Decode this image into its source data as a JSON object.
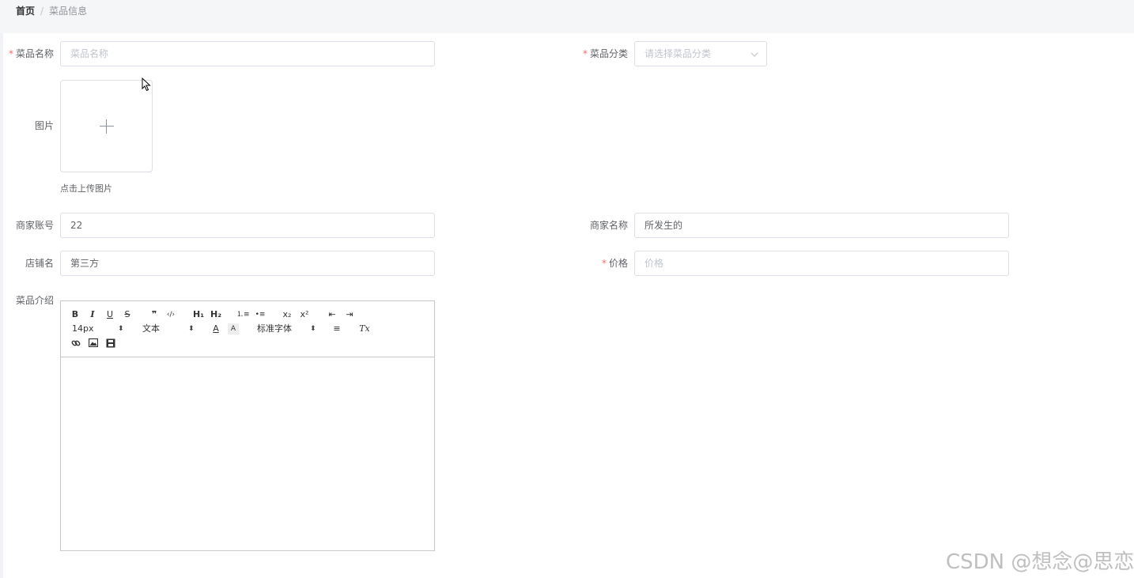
{
  "breadcrumb": {
    "home": "首页",
    "separator": "/",
    "current": "菜品信息"
  },
  "form": {
    "dish_name": {
      "label": "菜品名称",
      "required": true,
      "placeholder": "菜品名称",
      "value": ""
    },
    "category": {
      "label": "菜品分类",
      "required": true,
      "placeholder": "请选择菜品分类",
      "value": ""
    },
    "image": {
      "label": "图片",
      "tip": "点击上传图片"
    },
    "merchant_account": {
      "label": "商家账号",
      "value": "22"
    },
    "merchant_name": {
      "label": "商家名称",
      "value": "所发生的"
    },
    "shop_name": {
      "label": "店铺名",
      "value": "第三方"
    },
    "price": {
      "label": "价格",
      "required": true,
      "placeholder": "价格",
      "value": ""
    },
    "intro": {
      "label": "菜品介绍"
    }
  },
  "editor": {
    "buttons": {
      "bold": "B",
      "italic": "I",
      "underline": "U",
      "strike": "S",
      "blockquote": "❞",
      "code": "‹/›",
      "h1": "H₁",
      "h2": "H₂",
      "ordered_list": "⒈≡",
      "bullet_list": "•≡",
      "subscript": "x₂",
      "superscript": "x²",
      "outdent": "⇤",
      "indent": "⇥",
      "font_color": "A",
      "background": "A",
      "align": "≡",
      "clean": "Tx"
    },
    "size": "14px",
    "header": "文本",
    "font": "标准字体"
  },
  "watermark": "CSDN @想念@思恋"
}
